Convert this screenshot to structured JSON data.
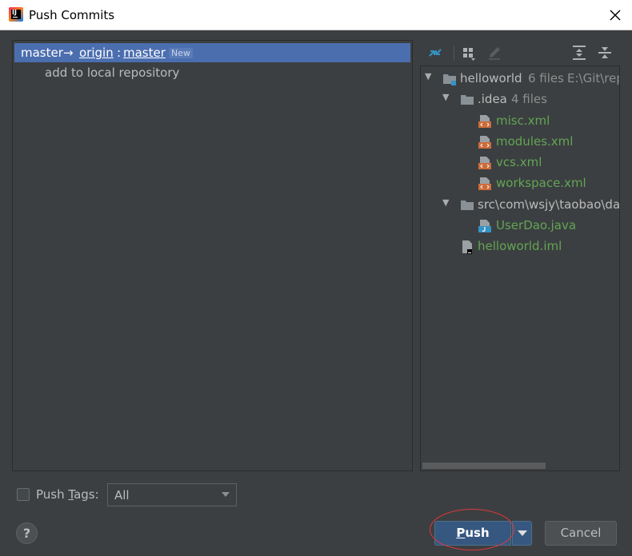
{
  "window": {
    "title": "Push Commits"
  },
  "push_tree": {
    "local_branch": "master",
    "arrow": "→",
    "remote": "origin",
    "separator": ":",
    "remote_branch": "master",
    "badge": "New",
    "commit": "add to local repository"
  },
  "toolbar": {
    "icons": [
      "expand-diff-icon",
      "group-by-icon",
      "edit-icon",
      "expand-all-icon",
      "collapse-all-icon"
    ]
  },
  "file_tree": {
    "root": {
      "name": "helloworld",
      "count": "6 files",
      "path": "E:\\Git\\rep"
    },
    "idea": {
      "name": ".idea",
      "count": "4 files"
    },
    "idea_files": [
      "misc.xml",
      "modules.xml",
      "vcs.xml",
      "workspace.xml"
    ],
    "src": {
      "name": "src\\com\\wsjy\\taobao\\da"
    },
    "src_files": [
      "UserDao.java"
    ],
    "root_files": [
      "helloworld.iml"
    ]
  },
  "footer": {
    "push_tags_prefix": "Push ",
    "push_tags_mnemonic": "T",
    "push_tags_suffix": "ags:",
    "tags_value": "All",
    "help": "?",
    "push_mnemonic": "P",
    "push_rest": "ush",
    "cancel": "Cancel"
  },
  "colors": {
    "background": "#3c3f41",
    "selection": "#4b6eaf",
    "changed_file": "#62a554",
    "primary_button": "#365880",
    "annotation": "#e0383e"
  }
}
